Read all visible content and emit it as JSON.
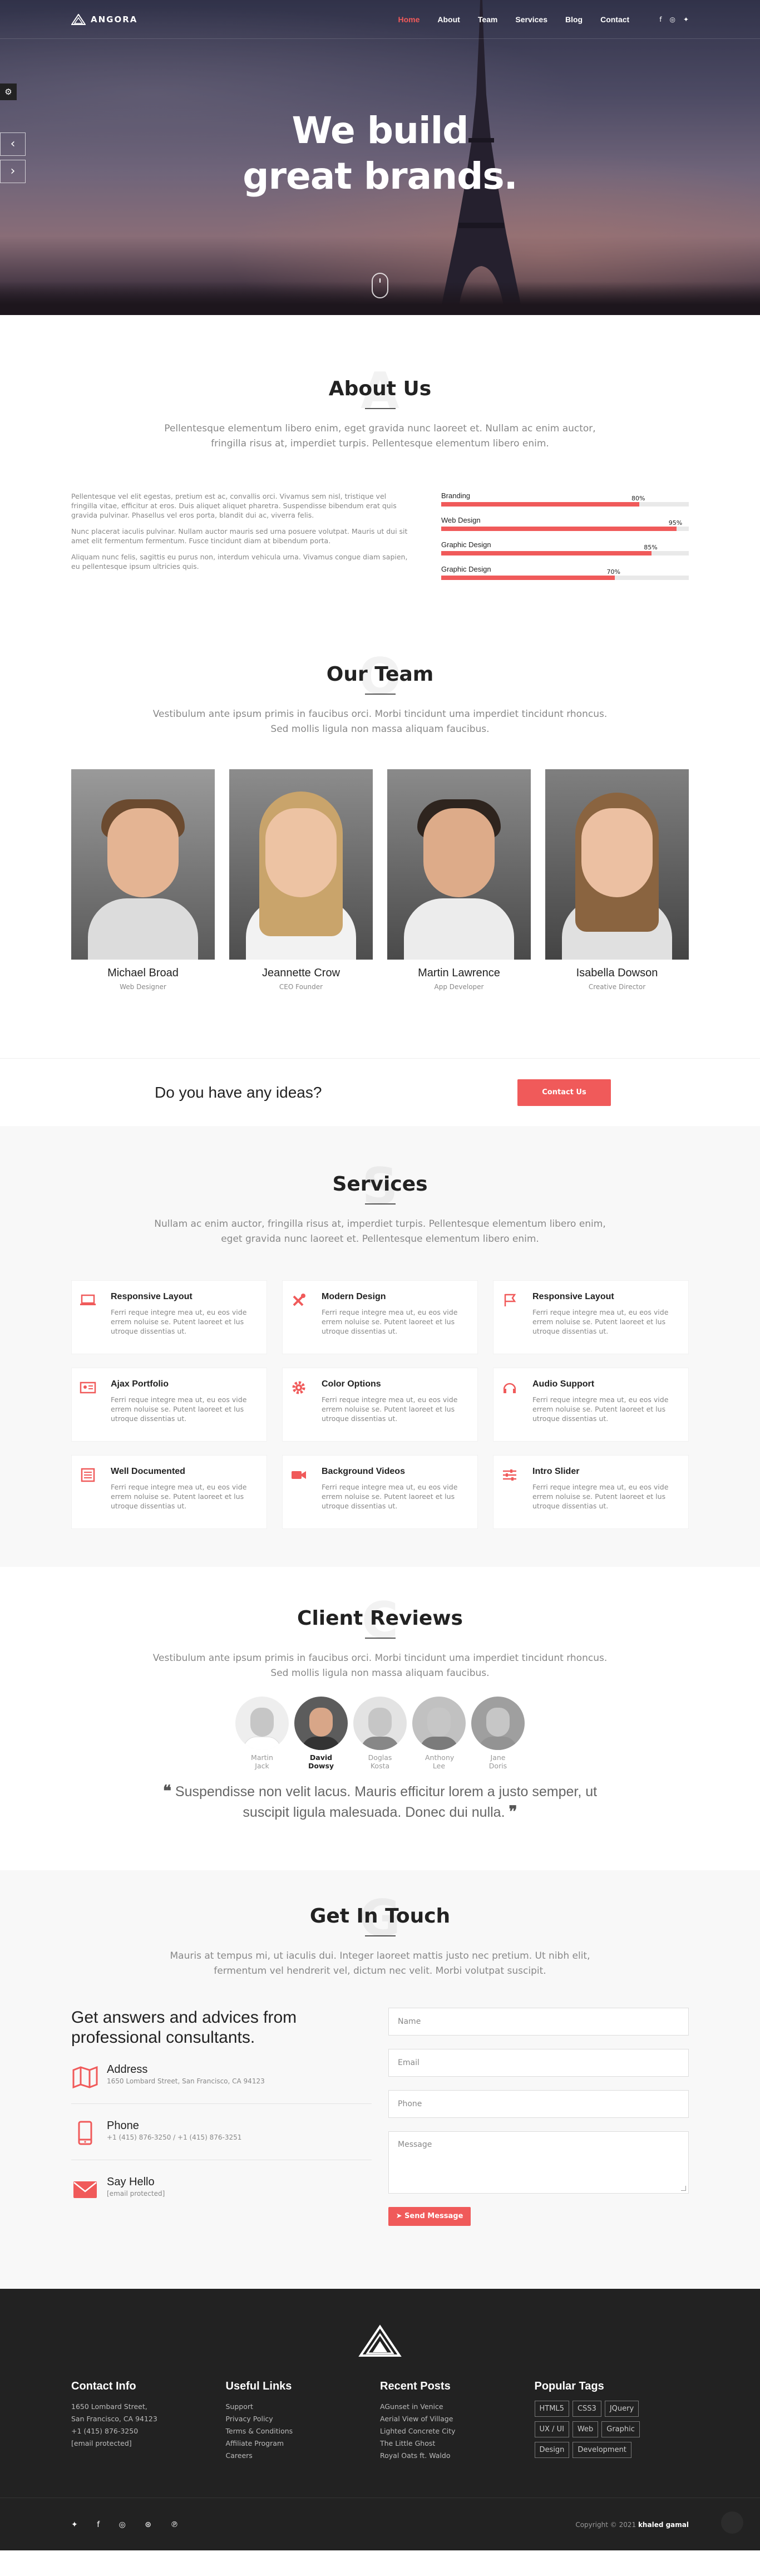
{
  "nav": {
    "brand": "ANGORA",
    "items": [
      "Home",
      "About",
      "Team",
      "Services",
      "Blog",
      "Contact"
    ],
    "social_icons": [
      "facebook-icon",
      "instagram-icon",
      "twitter-icon"
    ]
  },
  "hero": {
    "title_line1": "We build",
    "title_line2": "great brands."
  },
  "about": {
    "ghost": "A",
    "title": "About Us",
    "subtitle": "Pellentesque elementum libero enim, eget gravida nunc laoreet et. Nullam ac enim auctor, fringilla risus at, imperdiet turpis. Pellentesque elementum libero enim.",
    "paragraphs": [
      "Pellentesque vel elit egestas, pretium est ac, convallis orci. Vivamus sem nisl, tristique vel fringilla vitae, efficitur at eros. Duis aliquet aliquet pharetra. Suspendisse bibendum erat quis gravida pulvinar. Phasellus vel eros porta, blandit dui ac, viverra felis.",
      "Nunc placerat iaculis pulvinar. Nullam auctor mauris sed urna posuere volutpat. Mauris ut dui sit amet elit fermentum fermentum. Fusce tincidunt diam at bibendum porta.",
      "Aliquam nunc felis, sagittis eu purus non, interdum vehicula urna. Vivamus congue diam sapien, eu pellentesque ipsum ultricies quis."
    ],
    "skills": [
      {
        "label": "Branding",
        "percent": 80,
        "display": "80%"
      },
      {
        "label": "Web Design",
        "percent": 95,
        "display": "95%"
      },
      {
        "label": "Graphic Design",
        "percent": 85,
        "display": "85%"
      },
      {
        "label": "Graphic Design",
        "percent": 70,
        "display": "70%"
      }
    ]
  },
  "team": {
    "ghost": "O",
    "title": "Our Team",
    "subtitle": "Vestibulum ante ipsum primis in faucibus orci. Morbi tincidunt uma imperdiet tincidunt rhoncus. Sed mollis ligula non massa aliquam faucibus.",
    "members": [
      {
        "name": "Michael Broad",
        "role": "Web Designer"
      },
      {
        "name": "Jeannette Crow",
        "role": "CEO Founder"
      },
      {
        "name": "Martin Lawrence",
        "role": "App Developer"
      },
      {
        "name": "Isabella Dowson",
        "role": "Creative Director"
      }
    ]
  },
  "cta": {
    "question": "Do you have any ideas?",
    "button": "Contact Us"
  },
  "services": {
    "ghost": "S",
    "title": "Services",
    "subtitle": "Nullam ac enim auctor, fringilla risus at, imperdiet turpis. Pellentesque elementum libero enim, eget gravida nunc laoreet et. Pellentesque elementum libero enim.",
    "items": [
      {
        "icon": "laptop-icon",
        "title": "Responsive Layout",
        "text": "Ferri reque integre mea ut, eu eos vide errem noluise se. Putent laoreet et lus utroque dissentias ut."
      },
      {
        "icon": "tools-icon",
        "title": "Modern Design",
        "text": "Ferri reque integre mea ut, eu eos vide errem noluise se. Putent laoreet et lus utroque dissentias ut."
      },
      {
        "icon": "flag-icon",
        "title": "Responsive Layout",
        "text": "Ferri reque integre mea ut, eu eos vide errem noluise se. Putent laoreet et lus utroque dissentias ut."
      },
      {
        "icon": "id-card-icon",
        "title": "Ajax Portfolio",
        "text": "Ferri reque integre mea ut, eu eos vide errem noluise se. Putent laoreet et lus utroque dissentias ut."
      },
      {
        "icon": "gear-icon",
        "title": "Color Options",
        "text": "Ferri reque integre mea ut, eu eos vide errem noluise se. Putent laoreet et lus utroque dissentias ut."
      },
      {
        "icon": "headset-icon",
        "title": "Audio Support",
        "text": "Ferri reque integre mea ut, eu eos vide errem noluise se. Putent laoreet et lus utroque dissentias ut."
      },
      {
        "icon": "document-icon",
        "title": "Well Documented",
        "text": "Ferri reque integre mea ut, eu eos vide errem noluise se. Putent laoreet et lus utroque dissentias ut."
      },
      {
        "icon": "video-camera-icon",
        "title": "Background Videos",
        "text": "Ferri reque integre mea ut, eu eos vide errem noluise se. Putent laoreet et lus utroque dissentias ut."
      },
      {
        "icon": "sliders-icon",
        "title": "Intro Slider",
        "text": "Ferri reque integre mea ut, eu eos vide errem noluise se. Putent laoreet et lus utroque dissentias ut."
      }
    ]
  },
  "reviews": {
    "ghost": "C",
    "title": "Client Reviews",
    "subtitle": "Vestibulum ante ipsum primis in faucibus orci. Morbi tincidunt uma imperdiet tincidunt rhoncus. Sed mollis ligula non massa aliquam faucibus.",
    "clients": [
      {
        "name": "Martin Jack",
        "active": false
      },
      {
        "name": "David Dowsy",
        "active": true
      },
      {
        "name": "Doglas Kosta",
        "active": false
      },
      {
        "name": "Anthony Lee",
        "active": false
      },
      {
        "name": "Jane Doris",
        "active": false
      }
    ],
    "quote": "Suspendisse non velit lacus. Mauris efficitur lorem a justo semper, ut suscipit ligula malesuada. Donec dui nulla."
  },
  "contact": {
    "ghost": "G",
    "title": "Get In Touch",
    "subtitle": "Mauris at tempus mi, ut iaculis dui. Integer laoreet mattis justo nec pretium. Ut nibh elit, fermentum vel hendrerit vel, dictum nec velit. Morbi volutpat suscipit.",
    "heading": "Get answers and advices from professional consultants.",
    "items": [
      {
        "icon": "map-icon",
        "title": "Address",
        "text": "1650 Lombard Street, San Francisco, CA 94123"
      },
      {
        "icon": "phone-icon",
        "title": "Phone",
        "text": "+1 (415) 876-3250 / +1 (415) 876-3251"
      },
      {
        "icon": "envelope-icon",
        "title": "Say Hello",
        "text": "[email protected]"
      }
    ],
    "form": {
      "name_placeholder": "Name",
      "email_placeholder": "Email",
      "phone_placeholder": "Phone",
      "message_placeholder": "Message",
      "send": "Send Message"
    }
  },
  "footer": {
    "columns": [
      {
        "title": "Contact Info",
        "items": [
          "1650 Lombard Street,",
          "San Francisco, CA 94123",
          "+1 (415) 876-3250",
          "[email protected]"
        ]
      },
      {
        "title": "Useful Links",
        "items": [
          "Support",
          "Privacy Policy",
          "Terms & Conditions",
          "Affiliate Program",
          "Careers"
        ]
      },
      {
        "title": "Recent Posts",
        "items": [
          "AGunset in Venice",
          "Aerial View of Village",
          "Lighted Concrete City",
          "The Little Ghost",
          "Royal Oats ft. Waldo"
        ]
      }
    ],
    "tags_title": "Popular Tags",
    "tags": [
      "HTML5",
      "CSS3",
      "JQuery",
      "UX / UI",
      "Web",
      "Graphic",
      "Design",
      "Development"
    ],
    "social_icons": [
      "twitter-icon",
      "facebook-icon",
      "instagram-icon",
      "dribbble-icon",
      "pinterest-icon"
    ],
    "copyright_prefix": "Copyright © 2021",
    "copyright_author": "khaled gamal"
  },
  "colors": {
    "accent": "#f05a5a",
    "dark": "#222222"
  }
}
